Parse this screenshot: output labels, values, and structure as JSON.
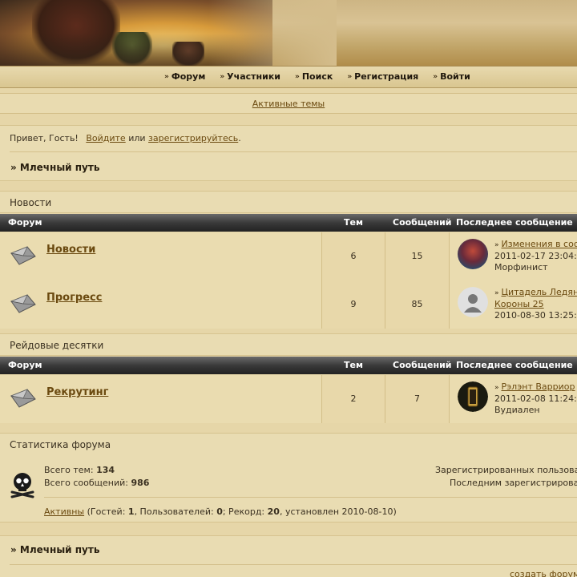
{
  "nav": {
    "items": [
      {
        "label": "Форум"
      },
      {
        "label": "Участники"
      },
      {
        "label": "Поиск"
      },
      {
        "label": "Регистрация"
      },
      {
        "label": "Войти"
      }
    ]
  },
  "active_topics_label": "Активные темы",
  "greeting": {
    "text": "Привет, Гость!",
    "login_link": "Войдите",
    "or": "или",
    "register_link": "зарегистрируйтесь",
    "period": "."
  },
  "breadcrumb": "» Млечный путь",
  "table_headers": {
    "forum": "Форум",
    "topics": "Тем",
    "posts": "Сообщений",
    "last_post": "Последнее сообщение"
  },
  "sections": [
    {
      "title": "Новости",
      "forums": [
        {
          "name": "Новости",
          "topics": "6",
          "posts": "15",
          "last_title": "Изменения в сос",
          "last_date": "2011-02-17 23:04:",
          "last_author": "Морфинист"
        },
        {
          "name": "Прогресс",
          "topics": "9",
          "posts": "85",
          "last_title": "Цитадель Ледяно",
          "last_title2": "Короны 25",
          "last_date": "2010-08-30 13:25:",
          "last_author": ""
        }
      ]
    },
    {
      "title": "Рейдовые десятки",
      "forums": [
        {
          "name": "Рекрутинг",
          "topics": "2",
          "posts": "7",
          "last_title": "Рэлэнт Варриор",
          "last_date": "2011-02-08 11:24:",
          "last_author": "Вудиален"
        }
      ]
    }
  ],
  "stats": {
    "title": "Статистика форума",
    "topics_label": "Всего тем:",
    "topics_value": "134",
    "posts_label": "Всего сообщений:",
    "posts_value": "986",
    "registered_label": "Зарегистрированных пользоват",
    "last_registered_label": "Последним зарегистрирован",
    "active_link": "Активны",
    "active_text_1": "(Гостей:",
    "guests": "1",
    "active_text_2": ", Пользователей:",
    "users": "0",
    "active_text_3": "; Рекорд:",
    "record": "20",
    "active_text_4": ", установлен 2010-08-10)"
  },
  "footer": {
    "breadcrumb": "» Млечный путь",
    "create_forum": "создать форум"
  }
}
